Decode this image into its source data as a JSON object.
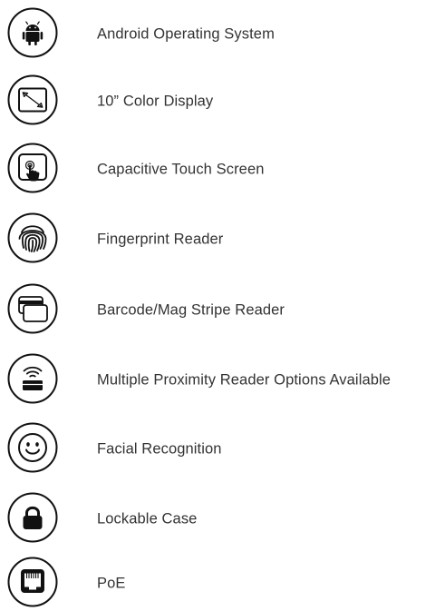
{
  "features": [
    {
      "icon": "android-icon",
      "label": "Android Operating System"
    },
    {
      "icon": "display-resize-icon",
      "label": "10” Color Display"
    },
    {
      "icon": "touch-screen-icon",
      "label": "Capacitive Touch Screen"
    },
    {
      "icon": "fingerprint-icon",
      "label": "Fingerprint Reader"
    },
    {
      "icon": "cards-icon",
      "label": "Barcode/Mag Stripe Reader"
    },
    {
      "icon": "proximity-reader-icon",
      "label": "Multiple Proximity Reader Options Available"
    },
    {
      "icon": "smiley-face-icon",
      "label": "Facial Recognition"
    },
    {
      "icon": "lock-icon",
      "label": "Lockable Case"
    },
    {
      "icon": "ethernet-port-icon",
      "label": "PoE"
    }
  ],
  "colors": {
    "icon_stroke": "#111111",
    "text": "#333333",
    "background": "#ffffff"
  }
}
